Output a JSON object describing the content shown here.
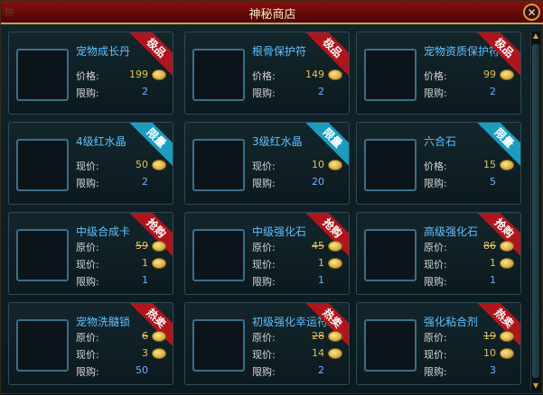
{
  "window": {
    "title": "神秘商店",
    "ghost_label": "物",
    "close_label": "✕"
  },
  "labels": {
    "price": "价格:",
    "orig_price": "原价:",
    "current_price": "现价:",
    "limit": "限购:"
  },
  "colors": {
    "tag_red": "#b0151d",
    "tag_teal": "#1b9cc0",
    "item_name": "#5fc0ff"
  },
  "items": [
    {
      "name": "宠物成长丹",
      "tag": "极品",
      "tag_color": "red",
      "price": "199",
      "limit": "2",
      "icon": "orange-orb-icon"
    },
    {
      "name": "根骨保护符",
      "tag": "极品",
      "tag_color": "red",
      "price": "149",
      "limit": "2",
      "icon": "blue-vortex-icon"
    },
    {
      "name": "宠物资质保护符",
      "tag": "极品",
      "tag_color": "red",
      "price": "99",
      "limit": "2",
      "icon": "green-scroll-icon"
    },
    {
      "name": "4级红水晶",
      "tag": "限量",
      "tag_color": "teal",
      "current": "50",
      "limit": "2",
      "icon": "red-crystal-icon"
    },
    {
      "name": "3级红水晶",
      "tag": "限量",
      "tag_color": "teal",
      "current": "10",
      "limit": "20",
      "icon": "red-crystal-icon"
    },
    {
      "name": "六合石",
      "tag": "限量",
      "tag_color": "teal",
      "price": "15",
      "limit": "5",
      "icon": "purple-stone-icon"
    },
    {
      "name": "中级合成卡",
      "tag": "抢购",
      "tag_color": "red",
      "orig": "59",
      "current": "1",
      "limit": "1",
      "icon": "blue-card-icon"
    },
    {
      "name": "中级强化石",
      "tag": "抢购",
      "tag_color": "red",
      "orig": "45",
      "current": "1",
      "limit": "1",
      "icon": "blue-gem-icon"
    },
    {
      "name": "高级强化石",
      "tag": "抢购",
      "tag_color": "red",
      "orig": "86",
      "current": "1",
      "limit": "1",
      "icon": "orange-gem-icon"
    },
    {
      "name": "宠物洗髓锁",
      "tag": "热卖",
      "tag_color": "red",
      "orig": "6",
      "current": "3",
      "limit": "50",
      "icon": "gold-lock-icon"
    },
    {
      "name": "初级强化幸运符",
      "tag": "热卖",
      "tag_color": "red",
      "orig": "28",
      "current": "14",
      "limit": "2",
      "icon": "green-scroll-icon"
    },
    {
      "name": "强化粘合剂",
      "tag": "热卖",
      "tag_color": "red",
      "orig": "19",
      "current": "10",
      "limit": "3",
      "icon": "purple-jar-icon"
    }
  ]
}
